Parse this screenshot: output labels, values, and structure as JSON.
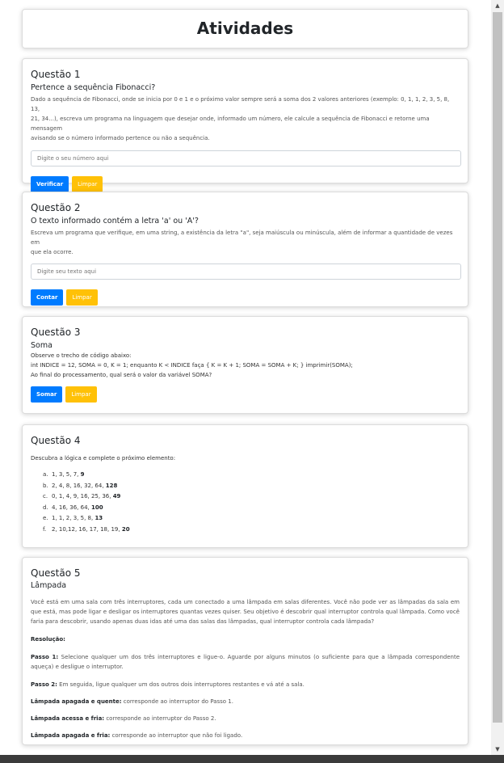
{
  "header": {
    "title": "Atividades"
  },
  "q1": {
    "title": "Questão 1",
    "subtitle": "Pertence a sequência Fibonacci?",
    "desc_lines": [
      "Dado a sequência de Fibonacci, onde se inicia por 0 e 1 e o próximo valor sempre será a soma dos 2 valores anteriores (exemplo: 0, 1, 1, 2, 3, 5, 8, 13,",
      "21, 34...), escreva um programa na linguagem que desejar onde, informado um número, ele calcule a sequência de Fibonacci e retorne uma mensagem",
      "avisando se o número informado pertence ou não a sequência."
    ],
    "placeholder": "Digite o seu número aqui",
    "btn_primary": "Verificar",
    "btn_clear": "Limpar"
  },
  "q2": {
    "title": "Questão 2",
    "subtitle": "O texto informado contém a letra 'a' ou 'A'?",
    "desc_lines": [
      "Escreva um programa que verifique, em uma string, a existência da letra \"a\", seja maiúscula ou minúscula, além de informar a quantidade de vezes em",
      "que ela ocorre."
    ],
    "placeholder": "Digite seu texto aqui",
    "btn_primary": "Contar",
    "btn_clear": "Limpar"
  },
  "q3": {
    "title": "Questão 3",
    "subtitle": "Soma",
    "lines": [
      "Observe o trecho de código abaixo:",
      "int INDICE = 12, SOMA = 0, K = 1; enquanto K < INDICE faça { K = K + 1; SOMA = SOMA + K; } imprimir(SOMA);",
      "Ao final do processamento, qual será o valor da variável SOMA?"
    ],
    "btn_primary": "Somar",
    "btn_clear": "Limpar"
  },
  "q4": {
    "title": "Questão 4",
    "intro": "Descubra a lógica e complete o próximo elemento:",
    "items": [
      {
        "letter": "a.",
        "seq": "1, 3, 5, 7, ",
        "answer": "9"
      },
      {
        "letter": "b.",
        "seq": "2, 4, 8, 16, 32, 64, ",
        "answer": "128"
      },
      {
        "letter": "c.",
        "seq": "0, 1, 4, 9, 16, 25, 36, ",
        "answer": "49"
      },
      {
        "letter": "d.",
        "seq": "4, 16, 36, 64, ",
        "answer": "100"
      },
      {
        "letter": "e.",
        "seq": "1, 1, 2, 3, 5, 8, ",
        "answer": "13"
      },
      {
        "letter": "f.",
        "seq": "2, 10,12, 16, 17, 18, 19, ",
        "answer": "20"
      }
    ]
  },
  "q5": {
    "title": "Questão 5",
    "subtitle": "Lâmpada",
    "intro": "Você está em uma sala com três interruptores, cada um conectado a uma lâmpada em salas diferentes. Você não pode ver as lâmpadas da sala em que está, mas pode ligar e desligar os interruptores quantas vezes quiser. Seu objetivo é descobrir qual interruptor controla qual lâmpada. Como você faria para descobrir, usando apenas duas idas até uma das salas das lâmpadas, qual interruptor controla cada lâmpada?",
    "resolution_label": "Resolução:",
    "step1_label": "Passo 1:",
    "step1_text": " Selecione qualquer um dos três interruptores e ligue-o. Aguarde por alguns minutos (o suficiente para que a lâmpada correspondente aqueça) e desligue o interruptor.",
    "step2_label": "Passo 2:",
    "step2_text": " Em seguida, ligue qualquer um dos outros dois interruptores restantes e vá até a sala.",
    "r1_label": "Lâmpada apagada e quente:",
    "r1_text": " corresponde ao interruptor do Passo 1.",
    "r2_label": "Lâmpada acessa e fria:",
    "r2_text": " corresponde ao interruptor do Passo 2.",
    "r3_label": "Lâmpada apagada e fria:",
    "r3_text": " corresponde ao interruptor que não foi ligado."
  },
  "colors": {
    "primary": "#007bff",
    "warning": "#ffc107"
  },
  "scrollbar": {
    "up_icon": "triangle-up",
    "down_icon": "triangle-down"
  }
}
